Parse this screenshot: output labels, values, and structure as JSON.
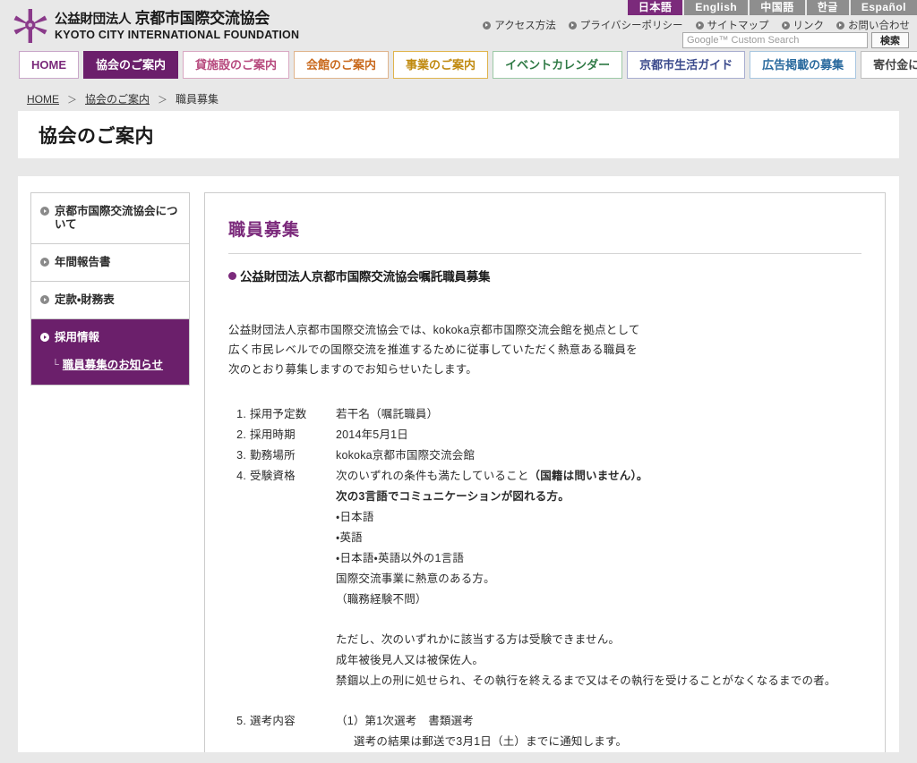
{
  "header": {
    "logo_jp_small": "公益財団法人",
    "logo_jp_main": "京都市国際交流協会",
    "logo_en": "KYOTO CITY INTERNATIONAL FOUNDATION",
    "logo_icon": "flower-asterisk-logo"
  },
  "languages": [
    {
      "label": "日本語",
      "active": true
    },
    {
      "label": "English",
      "active": false
    },
    {
      "label": "中国語",
      "active": false
    },
    {
      "label": "한글",
      "active": false
    },
    {
      "label": "Español",
      "active": false
    }
  ],
  "utility_links": [
    {
      "label": "アクセス方法"
    },
    {
      "label": "プライバシーポリシー"
    },
    {
      "label": "サイトマップ"
    },
    {
      "label": "リンク"
    },
    {
      "label": "お問い合わせ"
    }
  ],
  "search": {
    "placeholder": "Google™ Custom Search",
    "value": "",
    "button_label": "検索"
  },
  "nav_tabs": [
    {
      "label": "HOME",
      "variant": "v-purple",
      "active": false
    },
    {
      "label": "協会のご案内",
      "variant": "v-purple",
      "active": true
    },
    {
      "label": "貸施設のご案内",
      "variant": "v-pink",
      "active": false
    },
    {
      "label": "会館のご案内",
      "variant": "v-orange",
      "active": false
    },
    {
      "label": "事業のご案内",
      "variant": "v-amber",
      "active": false
    },
    {
      "label": "イベントカレンダー",
      "variant": "v-green",
      "active": false
    },
    {
      "label": "京都市生活ガイド",
      "variant": "v-indigo",
      "active": false
    },
    {
      "label": "広告掲載の募集",
      "variant": "v-blue",
      "active": false
    },
    {
      "label": "寄付金について",
      "variant": "v-gray",
      "active": false
    }
  ],
  "breadcrumb": {
    "home": "HOME",
    "sep": "＞",
    "level2": "協会のご案内",
    "current": "職員募集"
  },
  "page_title": "協会のご案内",
  "sidebar": {
    "items": [
      {
        "label": "京都市国際交流協会について",
        "active": false
      },
      {
        "label": "年間報告書",
        "active": false
      },
      {
        "label": "定款・財務表",
        "active": false
      },
      {
        "label": "採用情報",
        "active": true,
        "sub_tick": "└",
        "sub_label": "職員募集のお知らせ"
      }
    ]
  },
  "content": {
    "title": "職員募集",
    "subhead": "公益財団法人京都市国際交流協会嘱託職員募集",
    "intro_lines": [
      "公益財団法人京都市国際交流協会では、kokoka京都市国際交流会館を拠点として",
      "広く市民レベルでの国際交流を推進するために従事していただく熱意ある職員を",
      "次のとおり募集しますのでお知らせいたします。"
    ],
    "items": [
      {
        "num": "1.",
        "label": "採用予定数",
        "value": "若干名（嘱託職員）"
      },
      {
        "num": "2.",
        "label": "採用時期",
        "value": "2014年5月1日"
      },
      {
        "num": "3.",
        "label": "勤務場所",
        "value": "kokoka京都市国際交流会館"
      },
      {
        "num": "4.",
        "label": "受験資格",
        "value_plain": "次のいずれの条件も満たしていること",
        "value_bold": "（国籍は問いません）。"
      }
    ],
    "qualification_lines": [
      {
        "text": "次の3言語でコミュニケーションが図れる方。",
        "bold": true
      },
      {
        "text": "・日本語",
        "bold": false
      },
      {
        "text": "・英語",
        "bold": false
      },
      {
        "text": "・日本語・英語以外の1言語",
        "bold": false
      },
      {
        "text": "国際交流事業に熱意のある方。",
        "bold": false
      },
      {
        "text": "（職務経験不問）",
        "bold": false
      }
    ],
    "exclusion_lines": [
      "ただし、次のいずれかに該当する方は受験できません。",
      "成年被後見人又は被保佐人。",
      "禁錮以上の刑に処せられ、その執行を終えるまで又はその執行を受けることがなくなるまでの者。"
    ],
    "item5": {
      "num": "5.",
      "label": "選考内容",
      "value": "（1）第1次選考　書類選考",
      "sub_value": "選考の結果は郵送で3月1日（土）までに通知します。"
    }
  },
  "colors": {
    "brand_purple": "#6b1f6b",
    "accent_purple": "#7b2a7b",
    "page_bg": "#e8e8e8",
    "panel_bg": "#ffffff",
    "lang_inactive": "#8e8e8e"
  }
}
